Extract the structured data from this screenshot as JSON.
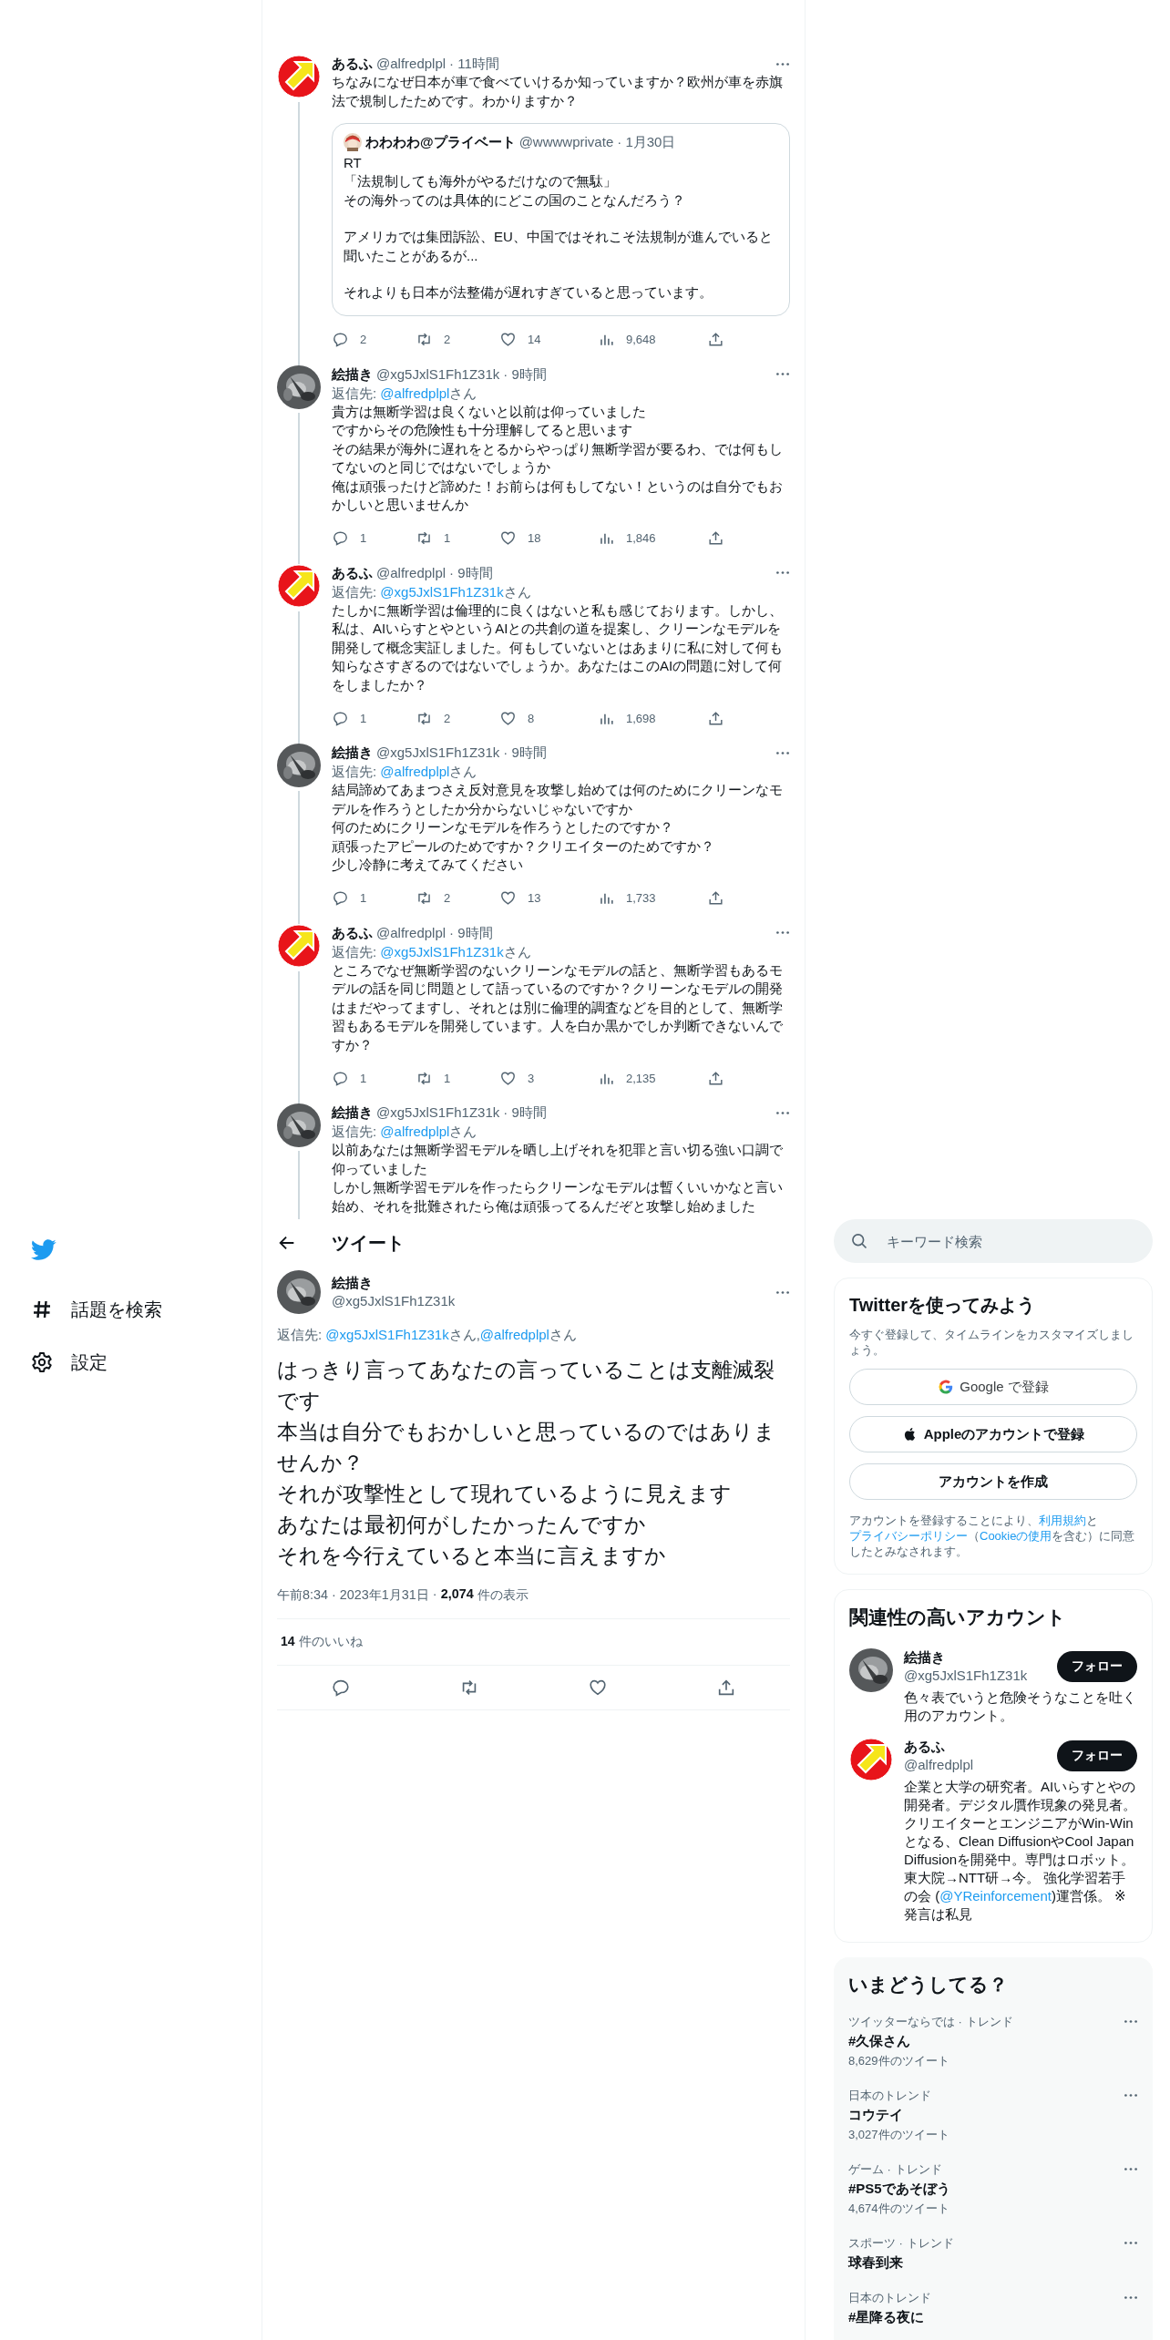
{
  "thread": [
    {
      "avatar": {
        "kind": "arrow"
      },
      "name": "あるふ",
      "handle": "@alfredplpl",
      "time": "· 11時間",
      "lines": [
        "ちなみになぜ日本が車で食べていけるか知っていますか？欧州が車を赤旗法で規制したためです。わかりますか？"
      ],
      "quote": {
        "name": "わわわわ@プライベート",
        "handle": "@wwwwprivate",
        "time": "· 1月30日",
        "paragraphs": [
          [
            "RT",
            "「法規制しても海外がやるだけなので無駄」",
            "その海外ってのは具体的にどこの国のことなんだろう？"
          ],
          [
            "アメリカでは集団訴訟、EU、中国ではそれこそ法規制が進んでいると聞いたことがあるが..."
          ],
          [
            "それよりも日本が法整備が遅れすぎていると思っています。"
          ]
        ]
      },
      "stats": {
        "replies": "2",
        "retweets": "2",
        "likes": "14",
        "views": "9,648"
      }
    },
    {
      "avatar": {
        "kind": "picture"
      },
      "name": "絵描き",
      "handle": "@xg5JxlS1Fh1Z31k",
      "time": "· 9時間",
      "reply_to": {
        "prefix": "返信先:",
        "mentions": [
          {
            "handle": "@alfredplpl",
            "suffix": "さん"
          }
        ]
      },
      "lines": [
        "貴方は無断学習は良くないと以前は仰っていました",
        "ですからその危険性も十分理解してると思います",
        "その結果が海外に遅れをとるからやっぱり無断学習が要るわ、では何もしてないのと同じではないでしょうか",
        "俺は頑張ったけど諦めた！お前らは何もしてない！というのは自分でもおかしいと思いませんか"
      ],
      "stats": {
        "replies": "1",
        "retweets": "1",
        "likes": "18",
        "views": "1,846"
      }
    },
    {
      "avatar": {
        "kind": "arrow"
      },
      "name": "あるふ",
      "handle": "@alfredplpl",
      "time": "· 9時間",
      "reply_to": {
        "prefix": "返信先:",
        "mentions": [
          {
            "handle": "@xg5JxlS1Fh1Z31k",
            "suffix": "さん"
          }
        ]
      },
      "lines": [
        "たしかに無断学習は倫理的に良くはないと私も感じております。しかし、私は、AIいらすとやというAIとの共創の道を提案し、クリーンなモデルを開発して概念実証しました。何もしていないとはあまりに私に対して何も知らなさすぎるのではないでしょうか。あなたはこのAIの問題に対して何をしましたか？"
      ],
      "stats": {
        "replies": "1",
        "retweets": "2",
        "likes": "8",
        "views": "1,698"
      }
    },
    {
      "avatar": {
        "kind": "picture"
      },
      "name": "絵描き",
      "handle": "@xg5JxlS1Fh1Z31k",
      "time": "· 9時間",
      "reply_to": {
        "prefix": "返信先:",
        "mentions": [
          {
            "handle": "@alfredplpl",
            "suffix": "さん"
          }
        ]
      },
      "lines": [
        "結局諦めてあまつさえ反対意見を攻撃し始めては何のためにクリーンなモデルを作ろうとしたか分からないじゃないですか",
        "何のためにクリーンなモデルを作ろうとしたのですか？",
        "頑張ったアピールのためですか？クリエイターのためですか？",
        "少し冷静に考えてみてください"
      ],
      "stats": {
        "replies": "1",
        "retweets": "2",
        "likes": "13",
        "views": "1,733"
      }
    },
    {
      "avatar": {
        "kind": "arrow"
      },
      "name": "あるふ",
      "handle": "@alfredplpl",
      "time": "· 9時間",
      "reply_to": {
        "prefix": "返信先:",
        "mentions": [
          {
            "handle": "@xg5JxlS1Fh1Z31k",
            "suffix": "さん"
          }
        ]
      },
      "lines": [
        "ところでなぜ無断学習のないクリーンなモデルの話と、無断学習もあるモデルの話を同じ問題として語っているのですか？クリーンなモデルの開発はまだやってますし、それとは別に倫理的調査などを目的として、無断学習もあるモデルを開発しています。人を白か黒かでしか判断できないんですか？"
      ],
      "stats": {
        "replies": "1",
        "retweets": "1",
        "likes": "3",
        "views": "2,135"
      }
    },
    {
      "avatar": {
        "kind": "picture"
      },
      "name": "絵描き",
      "handle": "@xg5JxlS1Fh1Z31k",
      "time": "· 9時間",
      "reply_to": {
        "prefix": "返信先:",
        "mentions": [
          {
            "handle": "@alfredplpl",
            "suffix": "さん"
          }
        ]
      },
      "lines": [
        "以前あなたは無断学習モデルを晒し上げそれを犯罪と言い切る強い口調で仰っていました",
        "しかし無断学習モデルを作ったらクリーンなモデルは暫くいいかなと言い始め、それを批難されたら俺は頑張ってるんだぞと攻撃し始めました"
      ]
    }
  ],
  "nav": [
    {
      "kind": "hashtag",
      "label": "話題を検索"
    },
    {
      "kind": "settings",
      "label": "設定"
    }
  ],
  "header": {
    "title": "ツイート"
  },
  "main_tweet": {
    "avatar": {
      "kind": "picture"
    },
    "name": "絵描き",
    "handle": "@xg5JxlS1Fh1Z31k",
    "reply_to": {
      "prefix": "返信先:",
      "mentions": [
        {
          "handle": "@xg5JxlS1Fh1Z31k",
          "suffix": "さん,"
        },
        {
          "handle": "@alfredplpl",
          "suffix": "さん"
        }
      ]
    },
    "lines": [
      "はっきり言ってあなたの言っていることは支離滅裂です",
      "本当は自分でもおかしいと思っているのではありませんか？",
      "それが攻撃性として現れているように見えます",
      "あなたは最初何がしたかったんですか",
      "それを今行えていると本当に言えますか"
    ],
    "time": "午前8:34",
    "date": "· 2023年1月31日",
    "views_sep": "·",
    "views": "2,074",
    "views_label": "件の表示",
    "likes": "14",
    "likes_label": "件のいいね"
  },
  "sidebar": {
    "search": {
      "placeholder": "キーワード検索"
    },
    "signup": {
      "title": "Twitterを使ってみよう",
      "subtitle": "今すぐ登録して、タイムラインをカスタマイズしましょう。",
      "buttons": [
        {
          "kind": "google",
          "label": "Google で登録"
        },
        {
          "kind": "apple",
          "label": "Appleのアカウントで登録"
        },
        {
          "kind": "create",
          "label": "アカウントを作成"
        }
      ],
      "legal": [
        {
          "kind": "text",
          "text": "アカウントを登録することにより、"
        },
        {
          "kind": "link",
          "text": "利用規約"
        },
        {
          "kind": "text",
          "text": "と"
        },
        {
          "kind": "link",
          "text": "プライバシーポリシー"
        },
        {
          "kind": "text",
          "text": "（"
        },
        {
          "kind": "link",
          "text": "Cookieの使用"
        },
        {
          "kind": "text",
          "text": "を含む）に同意したとみなされます。"
        }
      ]
    },
    "related": {
      "title": "関連性の高いアカウント",
      "accounts": [
        {
          "avatar": {
            "kind": "picture"
          },
          "name": "絵描き",
          "handle": "@xg5JxlS1Fh1Z31k",
          "follow": "フォロー",
          "bio": [
            {
              "kind": "text",
              "text": "色々表でいうと危険そうなことを吐く用のアカウント。"
            }
          ]
        },
        {
          "avatar": {
            "kind": "arrow"
          },
          "name": "あるふ",
          "handle": "@alfredplpl",
          "follow": "フォロー",
          "bio": [
            {
              "kind": "text",
              "text": "企業と大学の研究者。AIいらすとやの開発者。デジタル贋作現象の発見者。クリエイターとエンジニアがWin-Winとなる、Clean DiffusionやCool Japan Diffusionを開発中。専門はロボット。東大院→NTT研→今。 強化学習若手の会 ("
            },
            {
              "kind": "link",
              "text": "@YReinforcement"
            },
            {
              "kind": "text",
              "text": ")運営係。 ※発言は私見"
            }
          ]
        }
      ]
    },
    "trends": {
      "title": "いまどうしてる？",
      "items": [
        {
          "context": "ツイッターならでは · トレンド",
          "name": "#久保さん",
          "count": "8,629件のツイート"
        },
        {
          "context": "日本のトレンド",
          "name": "コウテイ",
          "count": "3,027件のツイート"
        },
        {
          "context": "ゲーム · トレンド",
          "name": "#PS5であそぼう",
          "count": "4,674件のツイート"
        },
        {
          "context": "スポーツ · トレンド",
          "name": "球春到来"
        },
        {
          "context": "日本のトレンド",
          "name": "#星降る夜に"
        }
      ]
    }
  }
}
